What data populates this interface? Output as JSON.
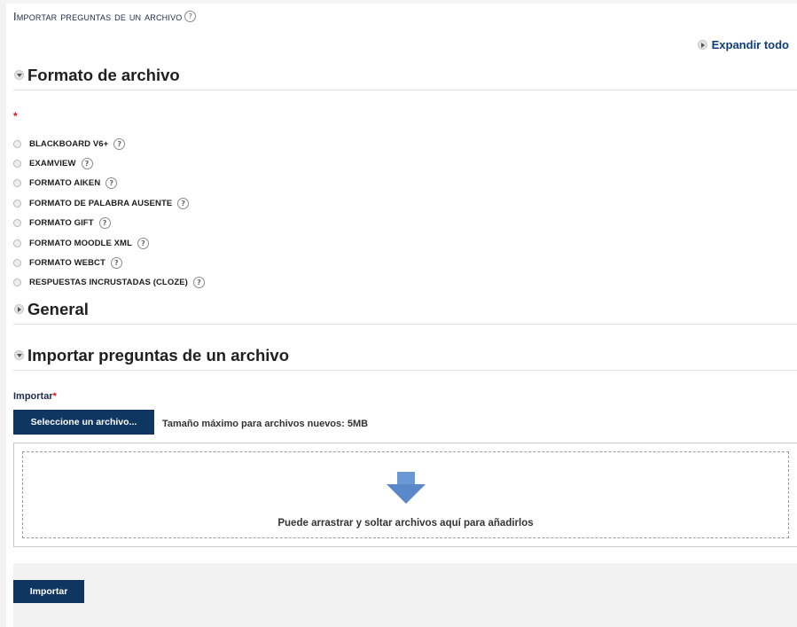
{
  "page": {
    "title": "Importar preguntas de un archivo",
    "help_icon": "help-icon"
  },
  "expand_all_label": "Expandir todo",
  "sections": {
    "file_format": {
      "title": "Formato de archivo",
      "state": "expanded"
    },
    "general": {
      "title": "General",
      "state": "collapsed"
    },
    "import_file": {
      "title": "Importar preguntas de un archivo",
      "state": "expanded"
    }
  },
  "required_marker": "*",
  "formats": [
    {
      "label": "BLACKBOARD V6+"
    },
    {
      "label": "EXAMVIEW"
    },
    {
      "label": "FORMATO AIKEN"
    },
    {
      "label": "FORMATO DE PALABRA AUSENTE"
    },
    {
      "label": "FORMATO GIFT"
    },
    {
      "label": "FORMATO MOODLE XML"
    },
    {
      "label": "FORMATO WEBCT"
    },
    {
      "label": "RESPUESTAS INCRUSTADAS (CLOZE)"
    }
  ],
  "import_field": {
    "label": "Importar",
    "required": "*",
    "choose_button": "Seleccione un archivo...",
    "max_size_text": "Tamaño máximo para archivos nuevos: 5MB",
    "dropzone_text": "Puede arrastrar y soltar archivos aquí para añadirlos"
  },
  "submit_button": "Importar",
  "colors": {
    "primary_button": "#0f3661",
    "link": "#0f3e7a",
    "required": "#dd1122",
    "drop_arrow": "#5b88c9"
  }
}
